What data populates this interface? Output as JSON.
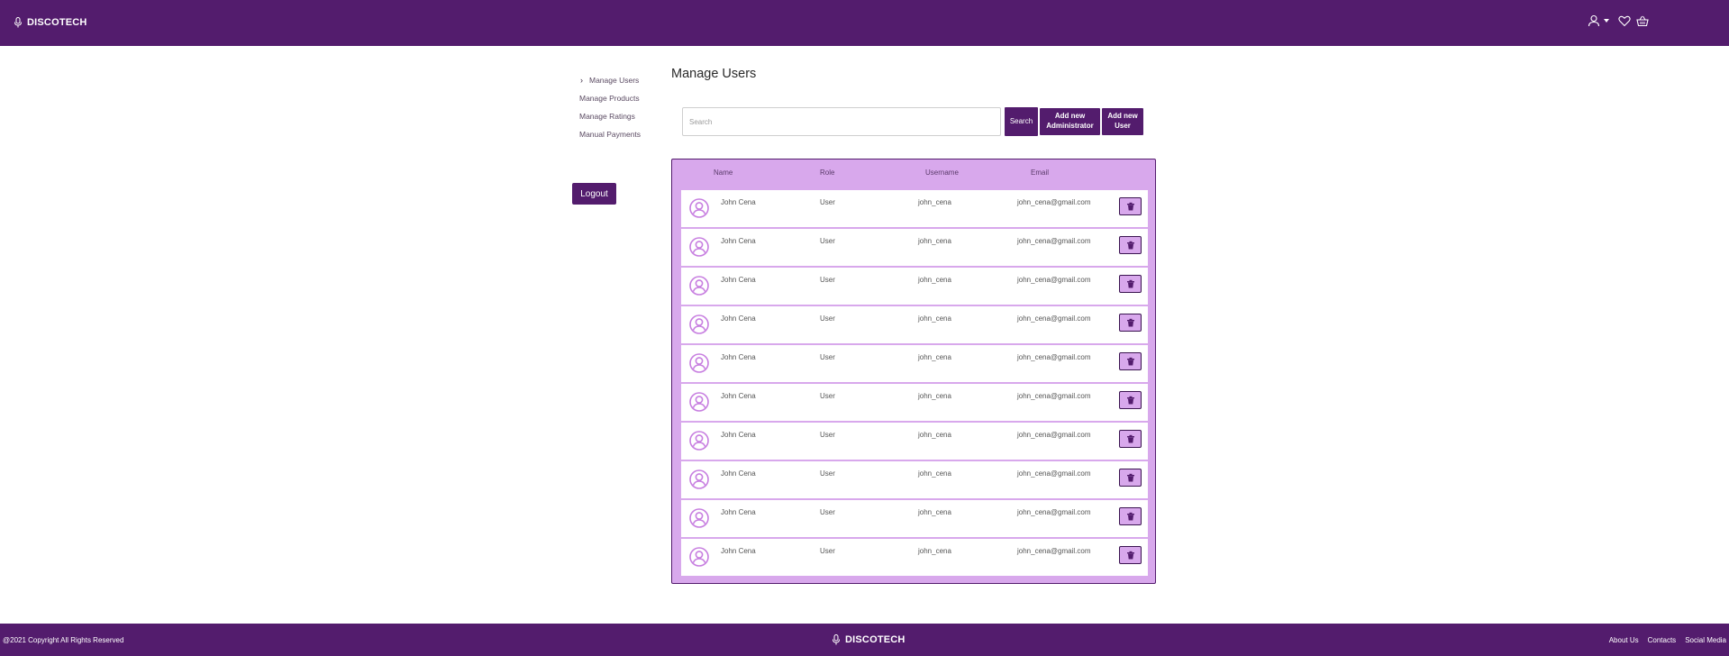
{
  "header": {
    "brand": "DISCOTECH"
  },
  "sidebar": {
    "items": [
      {
        "label": "Manage Users",
        "active": true
      },
      {
        "label": "Manage Products",
        "active": false
      },
      {
        "label": "Manage Ratings",
        "active": false
      },
      {
        "label": "Manual Payments",
        "active": false
      }
    ],
    "logout_label": "Logout"
  },
  "main": {
    "title": "Manage Users",
    "search": {
      "placeholder": "Search",
      "value": ""
    },
    "search_button": "Search",
    "add_admin_button": "Add new Administrator",
    "add_user_button": "Add new User"
  },
  "table": {
    "columns": [
      "Name",
      "Role",
      "Username",
      "Email"
    ],
    "rows": [
      {
        "name": "John Cena",
        "role": "User",
        "username": "john_cena",
        "email": "john_cena@gmail.com"
      },
      {
        "name": "John Cena",
        "role": "User",
        "username": "john_cena",
        "email": "john_cena@gmail.com"
      },
      {
        "name": "John Cena",
        "role": "User",
        "username": "john_cena",
        "email": "john_cena@gmail.com"
      },
      {
        "name": "John Cena",
        "role": "User",
        "username": "john_cena",
        "email": "john_cena@gmail.com"
      },
      {
        "name": "John Cena",
        "role": "User",
        "username": "john_cena",
        "email": "john_cena@gmail.com"
      },
      {
        "name": "John Cena",
        "role": "User",
        "username": "john_cena",
        "email": "john_cena@gmail.com"
      },
      {
        "name": "John Cena",
        "role": "User",
        "username": "john_cena",
        "email": "john_cena@gmail.com"
      },
      {
        "name": "John Cena",
        "role": "User",
        "username": "john_cena",
        "email": "john_cena@gmail.com"
      },
      {
        "name": "John Cena",
        "role": "User",
        "username": "john_cena",
        "email": "john_cena@gmail.com"
      },
      {
        "name": "John Cena",
        "role": "User",
        "username": "john_cena",
        "email": "john_cena@gmail.com"
      }
    ]
  },
  "footer": {
    "copyright": "@2021 Copyright All Rights Reserved",
    "brand": "DISCOTECH",
    "links": [
      "About Us",
      "Contacts",
      "Social Media"
    ]
  },
  "icons": {
    "brand": "microphone-icon",
    "user": "user-icon",
    "wishlist": "heart-icon",
    "cart": "basket-icon",
    "row_avatar": "user-avatar-icon",
    "delete": "trash-icon"
  },
  "colors": {
    "primary": "#531c6d",
    "table_bg": "#d8a8ec",
    "avatar": "#c77ee0"
  }
}
